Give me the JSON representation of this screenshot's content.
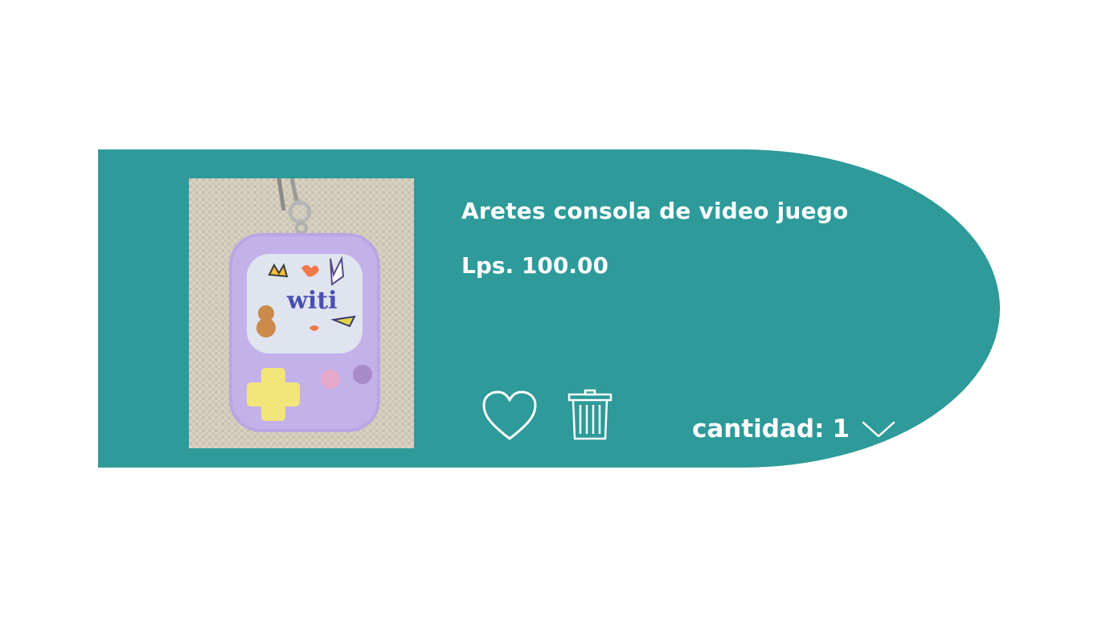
{
  "product": {
    "title": "Aretes consola de video juego",
    "price": "Lps. 100.00"
  },
  "quantity": {
    "label": "cantidad:",
    "value": "1"
  },
  "icons": {
    "favorite": "heart-icon",
    "delete": "trash-icon",
    "dropdown": "chevron-down-icon"
  },
  "colors": {
    "card_background": "#2e9a9a",
    "text": "#ffffff",
    "console_body": "#b9a6e3"
  }
}
